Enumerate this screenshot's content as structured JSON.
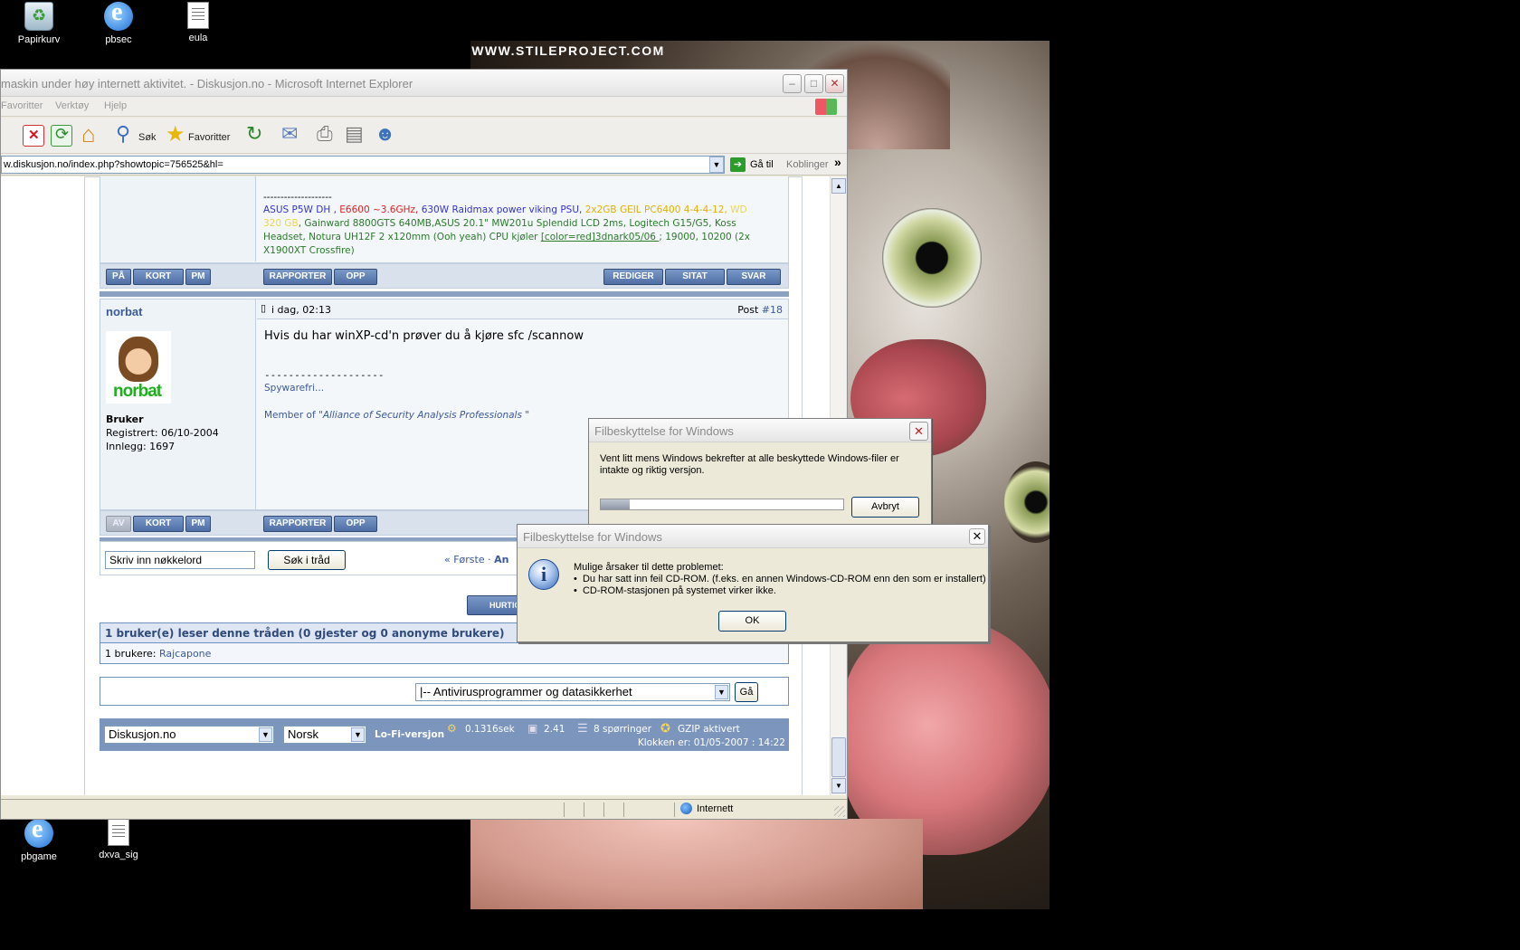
{
  "desktop": {
    "watermark": "WWW.STILEPROJECT.COM",
    "icons_top": [
      {
        "label": "Papirkurv",
        "icon": "recycle-bin-icon"
      },
      {
        "label": "pbsec",
        "icon": "internet-explorer-icon"
      },
      {
        "label": "eula",
        "icon": "text-document-icon"
      }
    ],
    "icons_bottom": [
      {
        "label": "pbgame",
        "icon": "internet-explorer-icon"
      },
      {
        "label": "dxva_sig",
        "icon": "text-document-icon"
      }
    ]
  },
  "browser": {
    "title": "maskin under høy internett aktivitet. - Diskusjon.no - Microsoft Internet Explorer",
    "menu": [
      "Favoritter",
      "Verktøy",
      "Hjelp"
    ],
    "toolbar": {
      "search": "Søk",
      "favorites": "Favoritter"
    },
    "address": "w.diskusjon.no/index.php?showtopic=756525&hl=",
    "go": "Gå til",
    "links": "Koblinger",
    "chevron": "»",
    "status_zone": "Internett"
  },
  "forum": {
    "prev_post": {
      "sig_divider": "--------------------",
      "hw_line1": {
        "a": "ASUS P5W DH , ",
        "b": "E6600 ~3.6GHz, ",
        "c": "630W Raidmax power viking PSU, ",
        "d": "2x2GB GEIL PC6400 4-4-4-12, ",
        "e": "WD"
      },
      "hw_line2": {
        "a": "320 GB",
        "b": ", Gainward 8800GTS 640MB,ASUS 20.1\" MW201u Splendid LCD 2ms, Logitech G15/G5, Koss"
      },
      "hw_line3": {
        "a": "Headset, Notura UH12F 2 x120mm (Ooh yeah) CPU kjøler ",
        "b": "[color=red]3dnark05/06 ",
        "c": "; 19000, 10200 (2x"
      },
      "hw_line4": "X1900XT Crossfire)",
      "left_buttons": [
        "PÅ",
        "KORT",
        "PM"
      ],
      "mid_buttons": [
        "RAPPORTER",
        "OPP"
      ],
      "right_buttons": [
        "REDIGER",
        "SITAT",
        "SVAR"
      ]
    },
    "post": {
      "author": "norbat",
      "time": "i dag, 02:13",
      "post_label": "Post ",
      "post_number": "#18",
      "avatar_name": "norbat",
      "role": "Bruker",
      "registered": "Registrert: 06/10-2004",
      "posts": "Innlegg: 1697",
      "body": "Hvis du har winXP-cd'n prøver du å kjøre sfc /scannow",
      "sig_divider": "--------------------",
      "sig1": "Spywarefri...",
      "sig2_prefix": "Member of \"",
      "sig2_link": "Alliance of Security Analysis Professionals",
      "sig2_suffix": " \"",
      "left_buttons": [
        "AV",
        "KORT",
        "PM"
      ],
      "mid_buttons": [
        "RAPPORTER",
        "OPP"
      ]
    },
    "search": {
      "placeholder": "Skriv inn nøkkelord",
      "button": "Søk i tråd"
    },
    "pager": {
      "first": "« Første",
      "dot": " · ",
      "partial": "An"
    },
    "quick_reply": "HURTIG",
    "readers": {
      "header": "1 bruker(e) leser denne tråden (0 gjester og 0 anonyme brukere)",
      "line_prefix": "1 brukere: ",
      "user": "Rajcapone"
    },
    "jump": {
      "selected": "|-- Antivirusprogrammer og datasikkerhet",
      "go": "Gå"
    },
    "footer": {
      "site_select": "Diskusjon.no",
      "lang_select": "Norsk",
      "lofi": "Lo-Fi-versjon",
      "time": "0.1316sek",
      "load": "2.41",
      "queries": "8 spørringer",
      "gzip": "GZIP aktivert",
      "clock": "Klokken er: 01/05-2007 : 14:22"
    }
  },
  "dialog_progress": {
    "title": "Filbeskyttelse for Windows",
    "message": "Vent litt mens Windows bekrefter at alle beskyttede Windows-filer er intakte og riktig versjon.",
    "progress": 0.12,
    "cancel": "Avbryt"
  },
  "dialog_error": {
    "title": "Filbeskyttelse for Windows",
    "heading": "Mulige årsaker til dette problemet:",
    "bullet1": "Du har satt inn feil CD-ROM.  (f.eks. en annen Windows-CD-ROM enn den som er installert)",
    "bullet2": "CD-ROM-stasjonen på systemet virker ikke.",
    "ok": "OK"
  },
  "colors": {
    "forum_blue": "#3b5998",
    "hw_blue": "#3333cc",
    "hw_red": "#dd2222",
    "hw_yellow": "#e0b000",
    "hw_green": "#2a7a2a"
  }
}
